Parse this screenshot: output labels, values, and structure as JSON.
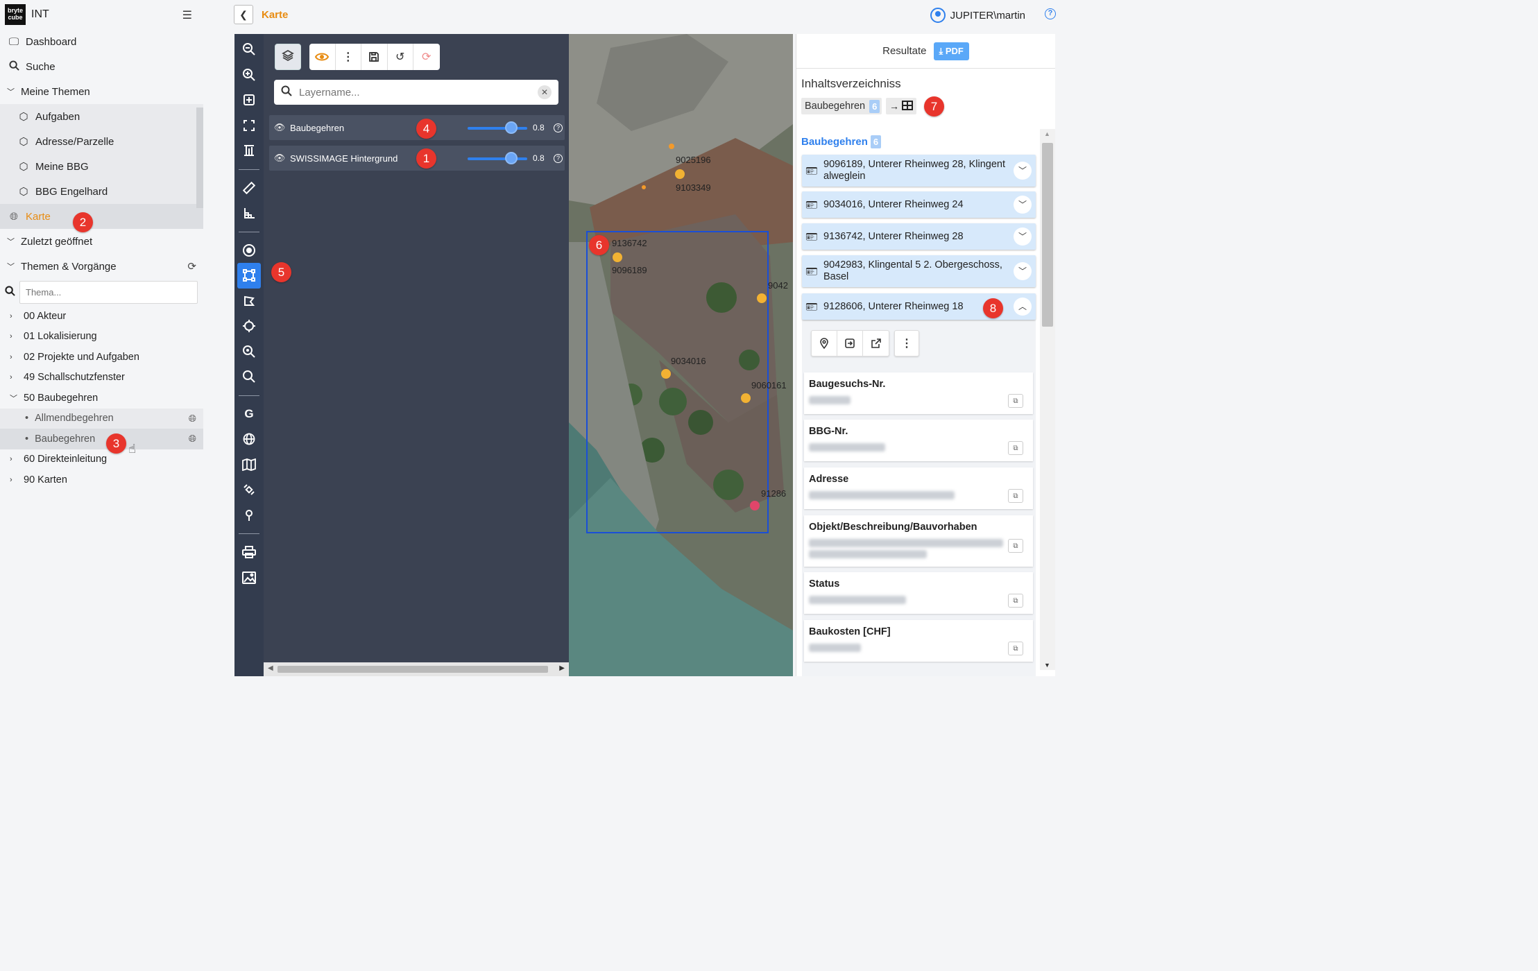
{
  "app": {
    "logo_text": "bryte cube",
    "name": "INT"
  },
  "sidebar": {
    "nav": [
      {
        "label": "Dashboard",
        "icon": "monitor-icon"
      },
      {
        "label": "Suche",
        "icon": "search-icon"
      }
    ],
    "meine_themen": {
      "label": "Meine Themen",
      "items": [
        {
          "label": "Aufgaben",
          "icon": "cube-icon"
        },
        {
          "label": "Adresse/Parzelle",
          "icon": "cube-icon"
        },
        {
          "label": "Meine BBG",
          "icon": "cube-icon"
        },
        {
          "label": "BBG Engelhard",
          "icon": "cube-icon"
        }
      ]
    },
    "karte_label": "Karte",
    "zuletzt_label": "Zuletzt geöffnet",
    "themen_label": "Themen & Vorgänge",
    "search_placeholder": "Thema...",
    "tree": [
      {
        "label": "00 Akteur"
      },
      {
        "label": "01 Lokalisierung"
      },
      {
        "label": "02 Projekte und Aufgaben"
      },
      {
        "label": "49 Schallschutzfenster"
      },
      {
        "label": "50 Baubegehren",
        "children": [
          {
            "label": "Allmendbegehren"
          },
          {
            "label": "Baubegehren"
          }
        ]
      },
      {
        "label": "60 Direkteinleitung"
      },
      {
        "label": "90 Karten"
      }
    ]
  },
  "header": {
    "title": "Karte",
    "user": "JUPITER\\martin"
  },
  "map": {
    "layer_search_placeholder": "Layername...",
    "layers": [
      {
        "name": "Baubegehren",
        "opacity": "0.8"
      },
      {
        "name": "SWISSIMAGE Hintergrund",
        "opacity": "0.8"
      }
    ],
    "labels": [
      "9025196",
      "9103349",
      "9136742",
      "9096189",
      "9034016",
      "9060161",
      "9042",
      "91286"
    ]
  },
  "results": {
    "title": "Resultate",
    "pdf_label": "PDF",
    "toc_title": "Inhaltsverzeichniss",
    "toc_chip": "Baubegehren",
    "count": "6",
    "group_label": "Baubegehren",
    "items": [
      {
        "text": "9096189, Unterer Rheinweg 28, Klingent alweglein"
      },
      {
        "text": "9034016, Unterer Rheinweg 24"
      },
      {
        "text": "9136742, Unterer Rheinweg 28"
      },
      {
        "text": "9042983, Klingental 5 2. Obergeschoss, Basel"
      },
      {
        "text": "9128606, Unterer Rheinweg 18"
      }
    ],
    "fields": [
      {
        "label": "Baugesuchs-Nr."
      },
      {
        "label": "BBG-Nr."
      },
      {
        "label": "Adresse"
      },
      {
        "label": "Objekt/Beschreibung/Bauvorhaben"
      },
      {
        "label": "Status"
      },
      {
        "label": "Baukosten [CHF]"
      }
    ]
  },
  "badges": [
    "1",
    "2",
    "3",
    "4",
    "5",
    "6",
    "7",
    "8"
  ],
  "colors": {
    "accent": "#e88c12",
    "primary": "#2f80ed",
    "badge": "#e8352c",
    "map_panel": "#3b4252"
  }
}
